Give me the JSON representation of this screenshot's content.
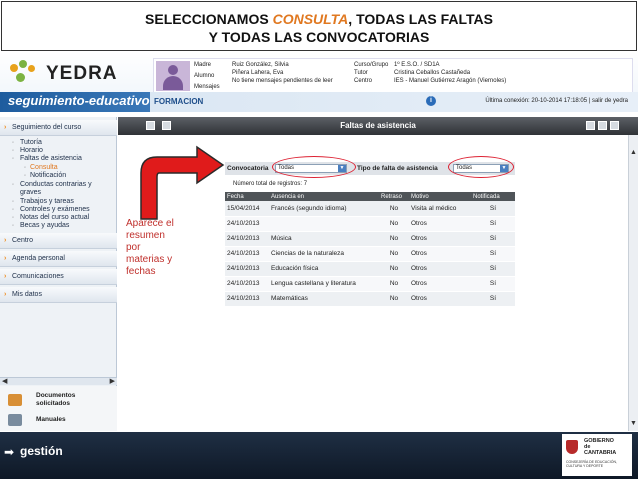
{
  "caption": {
    "line1_pre": "SELECCIONAMOS ",
    "line1_hl": "CONSULTA",
    "line1_post": ",  TODAS LAS FALTAS",
    "line2": "Y TODAS LAS CONVOCATORIAS"
  },
  "app": {
    "logo": "YEDRA",
    "subtitle": "seguimiento-educativo",
    "section": "FORMACION",
    "last_connection": "Última conexión: 20-10-2014 17:18:05 | salir de yedra"
  },
  "user": {
    "labels": [
      "Madre",
      "Alumno",
      "Mensajes"
    ],
    "madre": "Ruiz González, Silvia",
    "alumno": "Piñera Lahera, Eva",
    "mensajes": "No tiene mensajes pendientes de leer",
    "curso_label": "Curso/Grupo",
    "tutor_label": "Tutor",
    "centro_label": "Centro",
    "curso": "1º E.S.O. / SD1A",
    "tutor": "Cristina Ceballos Castañeda",
    "centro": "IES - Manuel Gutiérrez Aragón (Viernoles)"
  },
  "sidebar": {
    "items": [
      {
        "label": "Seguimiento del curso"
      },
      {
        "label": "Tutoría"
      },
      {
        "label": "Horario"
      },
      {
        "label": "Faltas de asistencia"
      },
      {
        "label": "Consulta"
      },
      {
        "label": "Notificación"
      },
      {
        "label": "Conductas contrarias y"
      },
      {
        "label": "graves"
      },
      {
        "label": "Trabajos y tareas"
      },
      {
        "label": "Controles y exámenes"
      },
      {
        "label": "Notas del curso actual"
      },
      {
        "label": "Becas y ayudas"
      },
      {
        "label": "Centro"
      },
      {
        "label": "Agenda personal"
      },
      {
        "label": "Comunicaciones"
      },
      {
        "label": "Mis datos"
      }
    ],
    "docs_line1": "Documentos",
    "docs_line2": "solicitados",
    "manuales": "Manuales"
  },
  "main": {
    "title": "Faltas de asistencia",
    "convocatoria_label": "Convocatoria",
    "convocatoria_value": "Todas",
    "tipo_label": "Tipo de falta de asistencia",
    "tipo_value": "Todas",
    "total": "Número total de registros: 7",
    "columns": [
      "Fecha",
      "Ausencia en",
      "Retraso",
      "Motivo",
      "Notificada"
    ],
    "rows": [
      [
        "15/04/2014",
        "Francés (segundo idioma)",
        "No",
        "Visita al médico",
        "Sí"
      ],
      [
        "24/10/2013",
        "",
        "No",
        "Otros",
        "Sí"
      ],
      [
        "24/10/2013",
        "Música",
        "No",
        "Otros",
        "Sí"
      ],
      [
        "24/10/2013",
        "Ciencias de la naturaleza",
        "No",
        "Otros",
        "Sí"
      ],
      [
        "24/10/2013",
        "Educación física",
        "No",
        "Otros",
        "Sí"
      ],
      [
        "24/10/2013",
        "Lengua castellana y literatura",
        "No",
        "Otros",
        "Sí"
      ],
      [
        "24/10/2013",
        "Matemáticas",
        "No",
        "Otros",
        "Sí"
      ]
    ]
  },
  "annotation": {
    "line1": "Aparece el",
    "line2": "resumen",
    "line3": "por",
    "line4": "materias y",
    "line5": "fechas"
  },
  "footer": {
    "gestion": "gestión",
    "gov1": "GOBIERNO",
    "gov2": "de",
    "gov3": "CANTABRIA",
    "gov4": "CONSEJERÍA DE EDUCACIÓN, CULTURA Y DEPORTE"
  },
  "colors": {
    "accent_orange": "#e07820",
    "nav_blue": "#1e5c9e",
    "annotation_red": "#c0302c"
  }
}
